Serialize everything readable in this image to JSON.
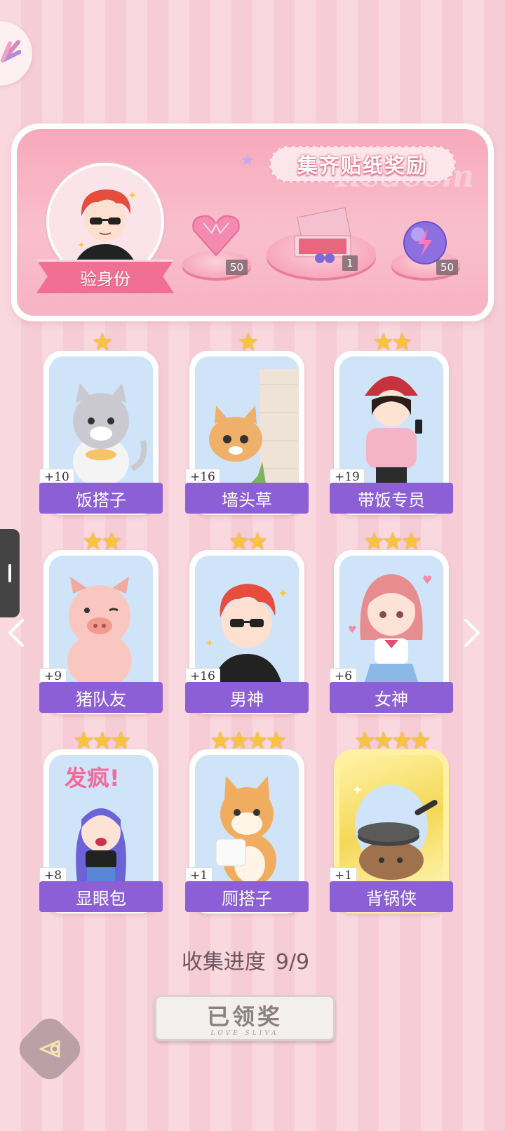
{
  "banner": {
    "title": "集齐贴纸奖励",
    "ghost_text": "Redeem",
    "verify_label": "验身份",
    "rewards": [
      {
        "icon": "heart-gem-icon",
        "count": "50"
      },
      {
        "icon": "gift-box-icon",
        "count": "1"
      },
      {
        "icon": "energy-orb-icon",
        "count": "50"
      }
    ]
  },
  "cards": [
    {
      "name": "饭搭子",
      "plus": "+10",
      "stars": "★"
    },
    {
      "name": "墙头草",
      "plus": "+16",
      "stars": "★"
    },
    {
      "name": "带饭专员",
      "plus": "+19",
      "stars": "★★"
    },
    {
      "name": "猪队友",
      "plus": "+9",
      "stars": "★★"
    },
    {
      "name": "男神",
      "plus": "+16",
      "stars": "★★"
    },
    {
      "name": "女神",
      "plus": "+6",
      "stars": "★★★"
    },
    {
      "name": "显眼包",
      "plus": "+8",
      "stars": "★★★"
    },
    {
      "name": "厕搭子",
      "plus": "+1",
      "stars": "★★★★"
    },
    {
      "name": "背锅侠",
      "plus": "+1",
      "stars": "★★★★"
    }
  ],
  "sticker_text": "发疯!",
  "progress": {
    "label": "收集进度",
    "value": "9/9"
  },
  "claim": {
    "label": "已领奖",
    "sub": "LOVE SLIVA"
  },
  "colors": {
    "label_purple": "#8d5fd6",
    "banner_pink": "#f7a9bb",
    "star_gold": "#f8c43a"
  }
}
